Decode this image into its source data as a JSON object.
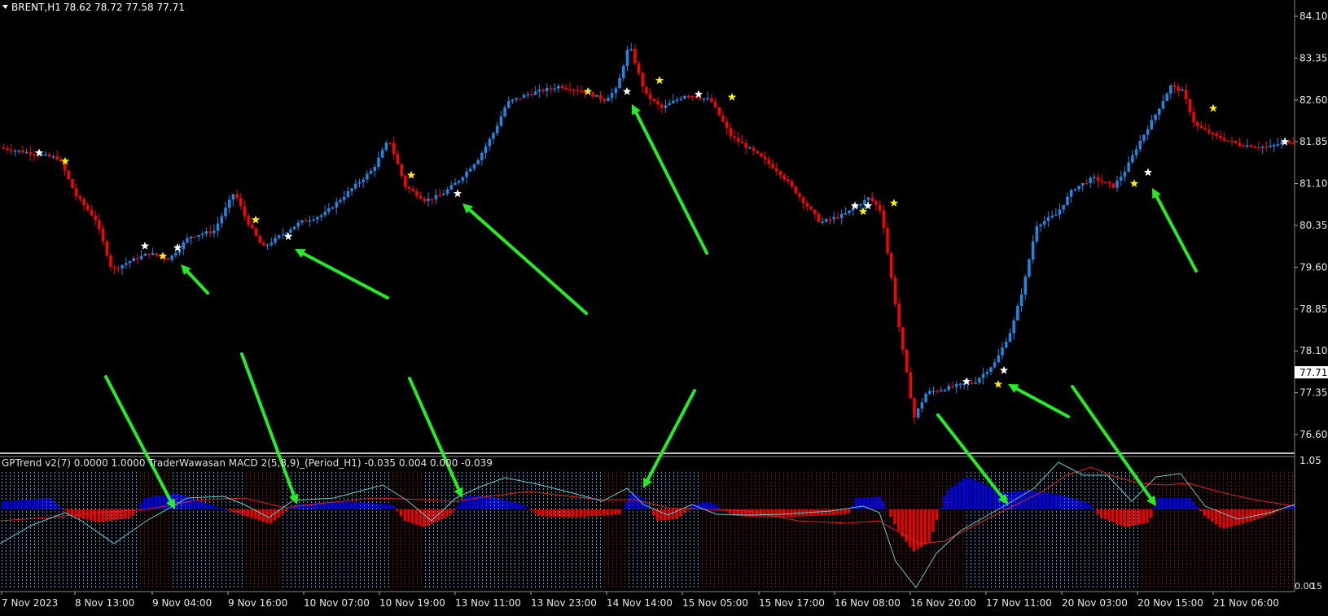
{
  "main_header": {
    "symbol": "BRENT,H1",
    "ohlc": "78.62 78.72 77.58 77.71"
  },
  "indicator_header": {
    "text": "GPTrend v2(7) 0.0000 1.0000   TraderWawasan MACD 2(5,8,9)_(Period_H1) -0.035 0.004 0.000 -0.039"
  },
  "price_axis": {
    "labels": [
      "84.10",
      "83.35",
      "82.60",
      "81.85",
      "81.10",
      "80.35",
      "79.60",
      "78.85",
      "78.10",
      "77.35",
      "76.60"
    ],
    "current_price": "77.71"
  },
  "indicator_axis": {
    "top": "1.05",
    "bottom": "0.00",
    "bottom_overlap": "15"
  },
  "time_axis": {
    "labels": [
      "7 Nov 2023",
      "8 Nov 13:00",
      "9 Nov 04:00",
      "9 Nov 16:00",
      "10 Nov 07:00",
      "10 Nov 19:00",
      "13 Nov 11:00",
      "13 Nov 23:00",
      "14 Nov 14:00",
      "15 Nov 05:00",
      "15 Nov 17:00",
      "16 Nov 08:00",
      "16 Nov 20:00",
      "17 Nov 11:00",
      "20 Nov 03:00",
      "20 Nov 15:00",
      "21 Nov 06:00"
    ]
  },
  "colors": {
    "background": "#000000",
    "bull": "#1e88e5",
    "bear": "#ff0000",
    "macd_pos": "#0000ee",
    "macd_neg": "#ee0000",
    "signal_line": "#e02020",
    "macd_line": "#66cccc",
    "arrow": "#22ee22",
    "star_white": "#ffffff",
    "star_yellow": "#ffee00",
    "trend_bull_dots": "#4fa0c8",
    "trend_bear_dots": "#7a1010"
  },
  "icons": {
    "menu": "triangle-down-icon",
    "signal_buy": "white-star-icon",
    "signal_sell": "yellow-star-icon",
    "annotation": "green-arrow-icon"
  }
}
